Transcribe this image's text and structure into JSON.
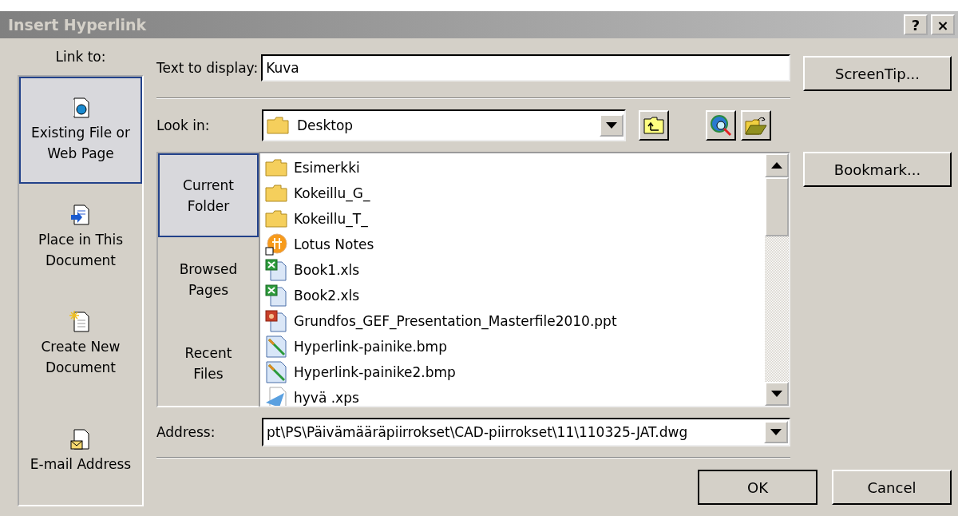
{
  "window": {
    "title": "Insert Hyperlink",
    "title_buttons": [
      "?",
      "×"
    ]
  },
  "link_to": {
    "label": "Link to:",
    "items": [
      {
        "kind": "file",
        "label": "Existing File or Web Page",
        "selected": true
      },
      {
        "kind": "place",
        "label": "Place in This Document",
        "selected": false
      },
      {
        "kind": "new",
        "label": "Create New Document",
        "selected": false
      },
      {
        "kind": "email",
        "label": "E-mail Address",
        "selected": false
      }
    ]
  },
  "text_to_display": {
    "label": "Text to display:",
    "value": "Kuva"
  },
  "screentip_button": "ScreenTip...",
  "look_in": {
    "label": "Look in:",
    "value": "Desktop"
  },
  "browse_tabs": [
    {
      "label": "Current Folder",
      "selected": true
    },
    {
      "label": "Browsed Pages",
      "selected": false
    },
    {
      "label": "Recent Files",
      "selected": false
    }
  ],
  "files": [
    {
      "kind": "folder",
      "name": "Esimerkki"
    },
    {
      "kind": "folder",
      "name": "Kokeillu_G_"
    },
    {
      "kind": "folder",
      "name": "Kokeillu_T_"
    },
    {
      "kind": "shortcut",
      "name": "Lotus Notes"
    },
    {
      "kind": "excel",
      "name": "Book1.xls"
    },
    {
      "kind": "excel",
      "name": "Book2.xls"
    },
    {
      "kind": "powerpoint",
      "name": "Grundfos_GEF_Presentation_Masterfile2010.ppt"
    },
    {
      "kind": "bitmap",
      "name": "Hyperlink-painike.bmp"
    },
    {
      "kind": "bitmap",
      "name": "Hyperlink-painike2.bmp"
    },
    {
      "kind": "xps",
      "name": "hyvä .xps"
    }
  ],
  "bookmark_button": "Bookmark...",
  "address": {
    "label": "Address:",
    "value": "pt\\PS\\Päivämääräpiirrokset\\CAD-piirrokset\\11\\110325-JAT.dwg"
  },
  "buttons": [
    "OK",
    "Cancel"
  ]
}
